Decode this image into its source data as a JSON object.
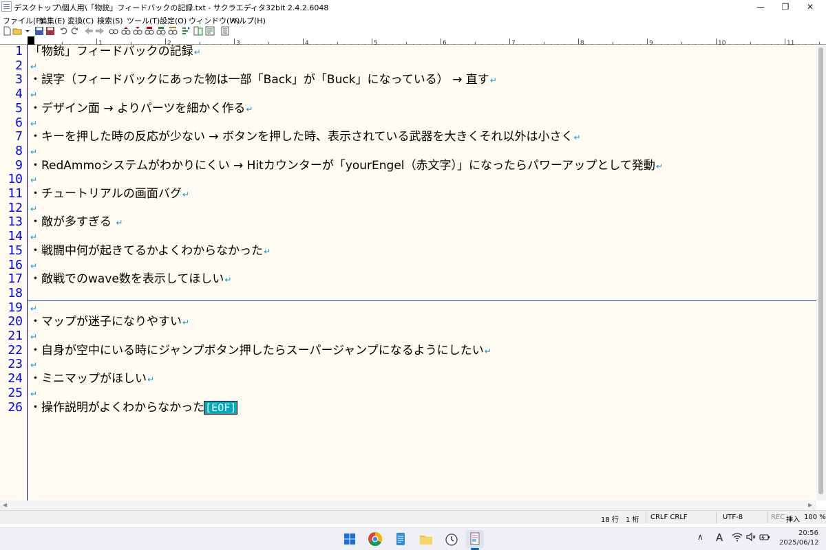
{
  "window": {
    "title": "デスクトップ\\個人用\\「物銃」フィードバックの記録.txt - サクラエディタ32bit 2.4.2.6048",
    "minimize_glyph": "—",
    "maximize_glyph": "❐",
    "close_glyph": "✕"
  },
  "menu": {
    "items": [
      "ファイル(F)",
      "編集(E)",
      "変換(C)",
      "検索(S)",
      "ツール(T)",
      "設定(O)",
      "ウィンドウ(W)",
      "ヘルプ(H)"
    ]
  },
  "toolbar": {
    "icons": [
      "new-file-icon",
      "open-folder-icon",
      "dropdown-icon",
      "save-icon",
      "save-all-icon",
      "undo-icon",
      "redo-icon",
      "back-icon",
      "forward-icon",
      "search-icon",
      "search-prev-icon",
      "search-next-icon",
      "replace-icon",
      "grep-icon",
      "jump-icon",
      "outline-icon",
      "compare-icon",
      "preview-icon",
      "print-icon"
    ]
  },
  "ruler": {
    "labels": [
      "0",
      "1",
      "2",
      "3",
      "4",
      "5",
      "6",
      "7",
      "8",
      "9",
      "10",
      "11"
    ]
  },
  "editor": {
    "line_numbers": [
      "1",
      "2",
      "3",
      "4",
      "5",
      "6",
      "7",
      "8",
      "9",
      "10",
      "11",
      "12",
      "13",
      "14",
      "15",
      "16",
      "17",
      "18",
      "19",
      "20",
      "21",
      "22",
      "23",
      "24",
      "25",
      "26"
    ],
    "lines": [
      "「物銃」フィードバックの記録",
      "",
      "・誤字（フィードバックにあった物は一部「Back」が「Buck」になっている） → 直す",
      "",
      "・デザイン面 → よりパーツを細かく作る",
      "",
      "・キーを押した時の反応が少ない → ボタンを押した時、表示されている武器を大きくそれ以外は小さく",
      "",
      "・RedAmmoシステムがわかりにくい → Hitカウンターが「yourEngel（赤文字）」になったらパワーアップとして発動",
      "",
      "・チュートリアルの画面バグ",
      "",
      "・敵が多すぎる ",
      "",
      "・戦闘中何が起きてるかよくわからなかった",
      "",
      "・敵戦でのwave数を表示してほしい",
      "",
      "",
      "・マップが迷子になりやすい",
      "",
      "・自身が空中にいる時にジャンプボタン押したらスーパージャンプになるようにしたい",
      "",
      "・ミニマップがほしい",
      "",
      "・操作説明がよくわからなかった"
    ],
    "newline_marker": "↵",
    "eof_marker": "[EOF]",
    "cursor_line": 18
  },
  "status": {
    "row": "18 行",
    "col": "1 桁",
    "newline": "CRLF CRLF",
    "encoding": "UTF-8",
    "rec": "REC",
    "insert": "挿入",
    "zoom": "100 %"
  },
  "taskbar": {
    "apps": [
      "windows-start-icon",
      "chrome-icon",
      "notepad-icon",
      "file-explorer-icon",
      "clock-app-icon",
      "sakura-editor-icon"
    ],
    "tray_chevron": "∧",
    "ime": "A",
    "clock_time": "20:56",
    "clock_date": "2025/06/12",
    "colors": {
      "accent": "#0067c0",
      "line_number": "#0000ff",
      "eof_bg": "#00a8c0",
      "editor_bg": "#fffbf0"
    }
  }
}
